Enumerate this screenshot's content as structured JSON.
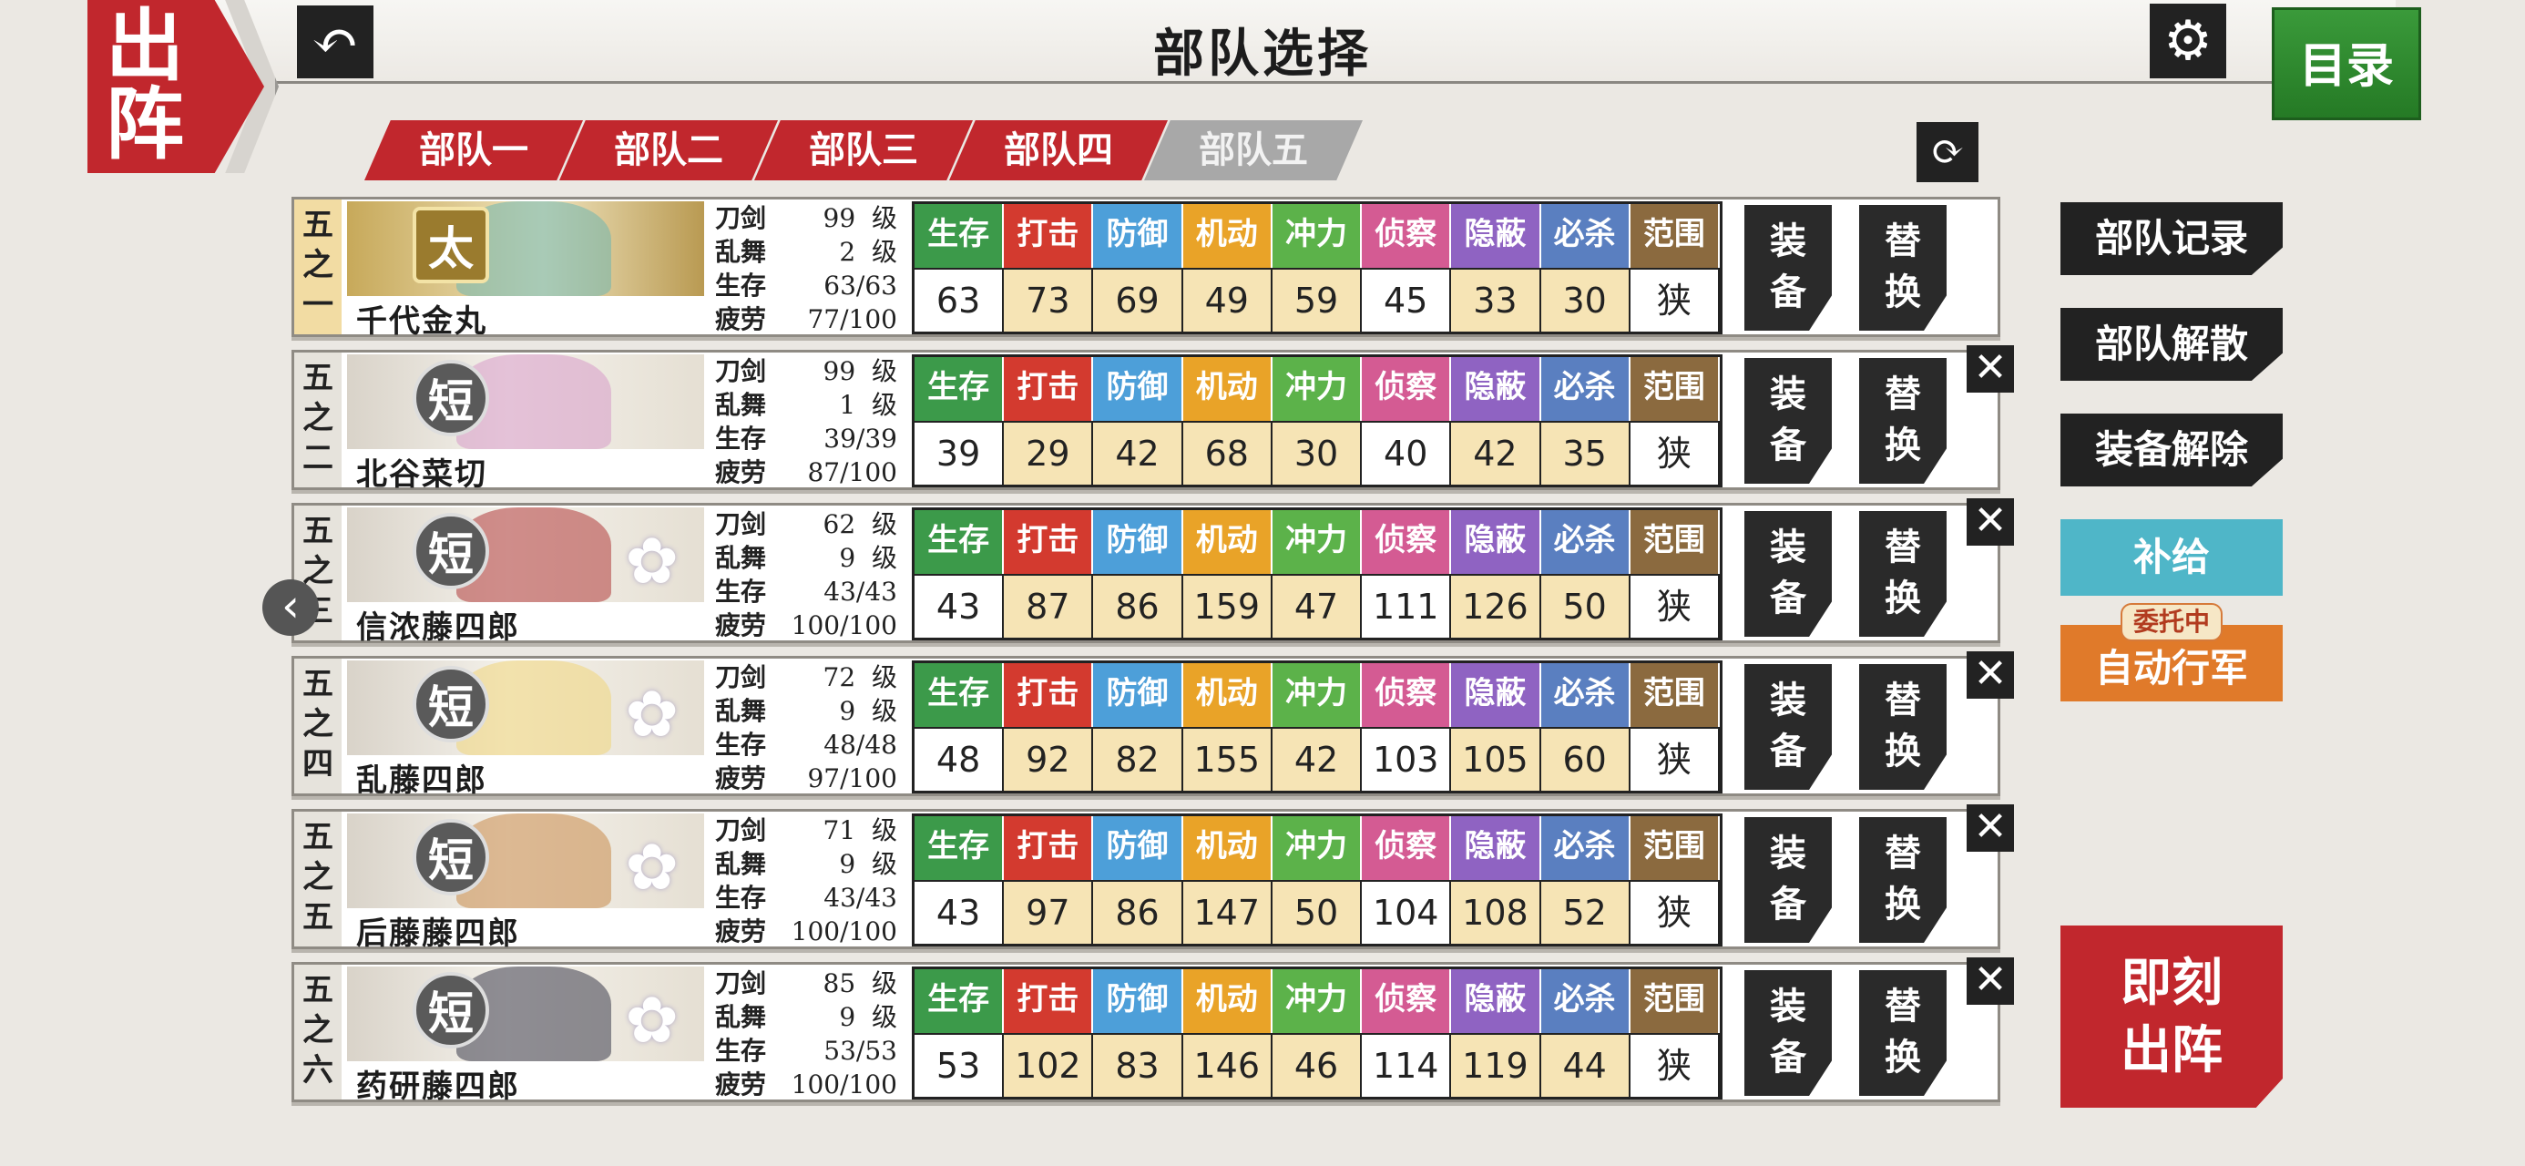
{
  "header": {
    "title": "部队选择",
    "sortie_label": [
      "出",
      "阵"
    ],
    "catalog_label": "目录"
  },
  "tabs": [
    "部队一",
    "部队二",
    "部队三",
    "部队四",
    "部队五"
  ],
  "active_tab": 3,
  "stat_headers": [
    "生存",
    "打击",
    "防御",
    "机动",
    "冲力",
    "侦察",
    "隐蔽",
    "必杀",
    "范围"
  ],
  "stat_colors": [
    "#3c9a4a",
    "#d33a2f",
    "#4d9fd9",
    "#e9a328",
    "#5cb24a",
    "#d45b93",
    "#8f63c2",
    "#5a7fc0",
    "#8b6a3f"
  ],
  "info_labels": {
    "sword": "刀剑",
    "ranbu": "乱舞",
    "hp": "生存",
    "fatigue": "疲劳"
  },
  "level_unit": "级",
  "button_labels": {
    "equip": [
      "装",
      "备"
    ],
    "swap": [
      "替",
      "换"
    ]
  },
  "units": [
    {
      "slot": [
        "五",
        "之",
        "一"
      ],
      "type": "太",
      "name": "千代金丸",
      "level": "99",
      "ranbu": "2",
      "hp": "63/63",
      "fatigue": "77/100",
      "stats": [
        "63",
        "73",
        "69",
        "49",
        "59",
        "45",
        "33",
        "30",
        "狭"
      ]
    },
    {
      "slot": [
        "五",
        "之",
        "二"
      ],
      "type": "短",
      "name": "北谷菜切",
      "level": "99",
      "ranbu": "1",
      "hp": "39/39",
      "fatigue": "87/100",
      "stats": [
        "39",
        "29",
        "42",
        "68",
        "30",
        "40",
        "42",
        "35",
        "狭"
      ]
    },
    {
      "slot": [
        "五",
        "之",
        "三"
      ],
      "type": "短",
      "name": "信浓藤四郎",
      "level": "62",
      "ranbu": "9",
      "hp": "43/43",
      "fatigue": "100/100",
      "stats": [
        "43",
        "87",
        "86",
        "159",
        "47",
        "111",
        "126",
        "50",
        "狭"
      ]
    },
    {
      "slot": [
        "五",
        "之",
        "四"
      ],
      "type": "短",
      "name": "乱藤四郎",
      "level": "72",
      "ranbu": "9",
      "hp": "48/48",
      "fatigue": "97/100",
      "stats": [
        "48",
        "92",
        "82",
        "155",
        "42",
        "103",
        "105",
        "60",
        "狭"
      ]
    },
    {
      "slot": [
        "五",
        "之",
        "五"
      ],
      "type": "短",
      "name": "后藤藤四郎",
      "level": "71",
      "ranbu": "9",
      "hp": "43/43",
      "fatigue": "100/100",
      "stats": [
        "43",
        "97",
        "86",
        "147",
        "50",
        "104",
        "108",
        "52",
        "狭"
      ]
    },
    {
      "slot": [
        "五",
        "之",
        "六"
      ],
      "type": "短",
      "name": "药研藤四郎",
      "level": "85",
      "ranbu": "9",
      "hp": "53/53",
      "fatigue": "100/100",
      "stats": [
        "53",
        "102",
        "83",
        "146",
        "46",
        "114",
        "119",
        "44",
        "狭"
      ]
    }
  ],
  "right_panel": {
    "record": "部队记录",
    "disband": "部队解散",
    "unequip": "装备解除",
    "supply": "补给",
    "auto_march": "自动行军",
    "auto_tag": "委托中",
    "launch": [
      "即刻",
      "出阵"
    ]
  },
  "icons": {
    "back": "back-arrow-icon",
    "settings": "gear-icon",
    "refresh": "refresh-icon",
    "remove": "close-icon",
    "prev": "chevron-left-icon"
  }
}
